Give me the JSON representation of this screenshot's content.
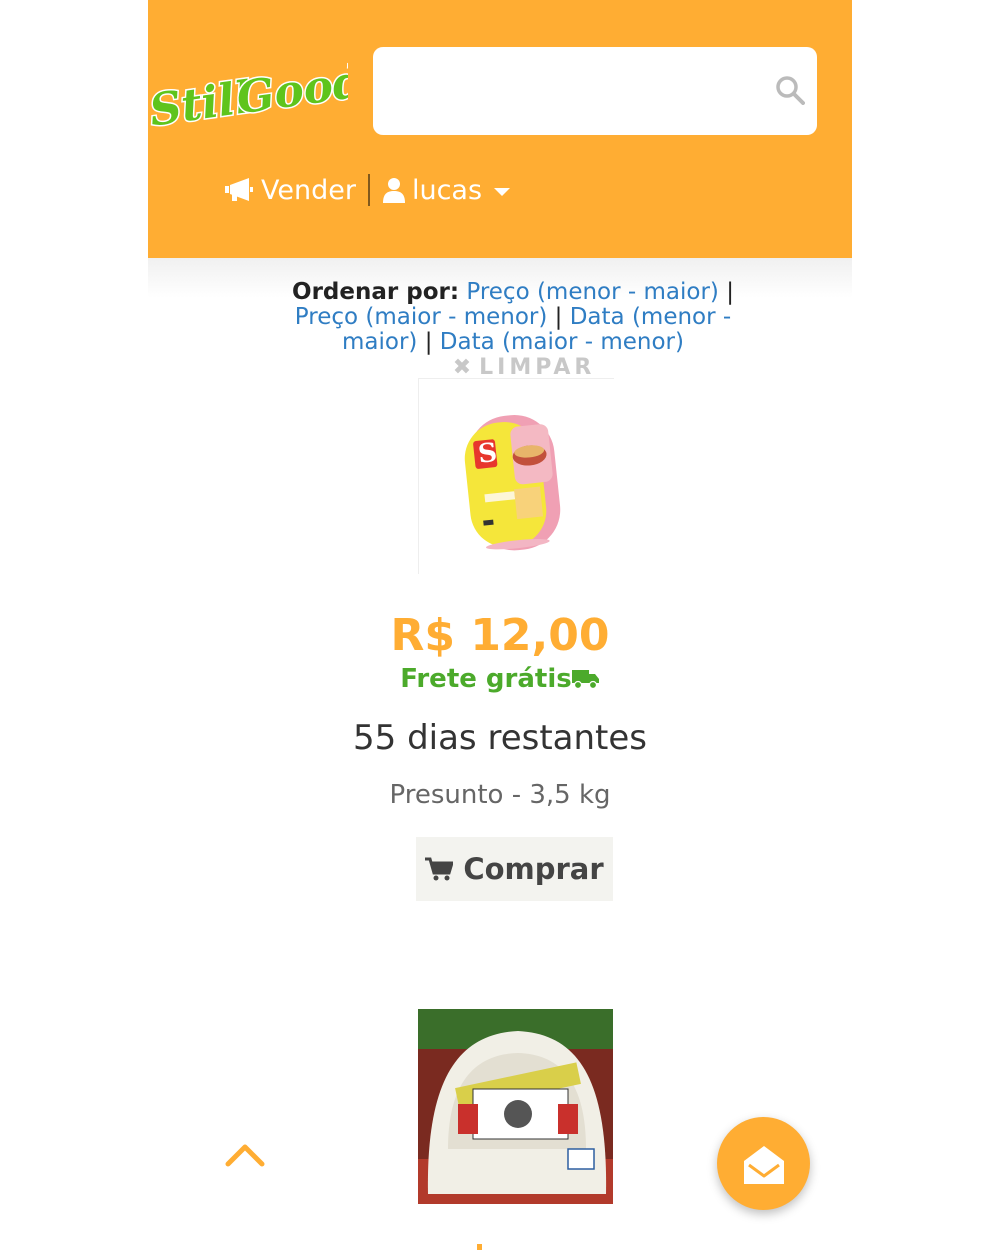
{
  "brand": {
    "name": "Still Good",
    "primary_color": "#ffad33",
    "logo_green": "#5fc41c"
  },
  "search": {
    "placeholder": "",
    "value": ""
  },
  "nav": {
    "sell_label": "Vender",
    "user_label": "lucas"
  },
  "sort": {
    "label": "Ordenar por:",
    "options": [
      "Preço (menor - maior)",
      "Preço (maior - menor)",
      "Data (menor - maior)",
      "Data (maior - menor)"
    ],
    "separator": "|",
    "clear_label": "LIMPAR"
  },
  "product": {
    "price": "R$ 12,00",
    "shipping": "Frete grátis",
    "days_left": "55 dias restantes",
    "name": "Presunto - 3,5 kg",
    "buy_label": "Comprar",
    "image_icon": "presunto-package-image"
  },
  "next_product": {
    "image_icon": "queijo-minas-image"
  },
  "icons": [
    "search-icon",
    "megaphone-icon",
    "user-icon",
    "caret-down-icon",
    "truck-icon",
    "cart-icon",
    "chevron-up-icon",
    "envelope-icon"
  ]
}
